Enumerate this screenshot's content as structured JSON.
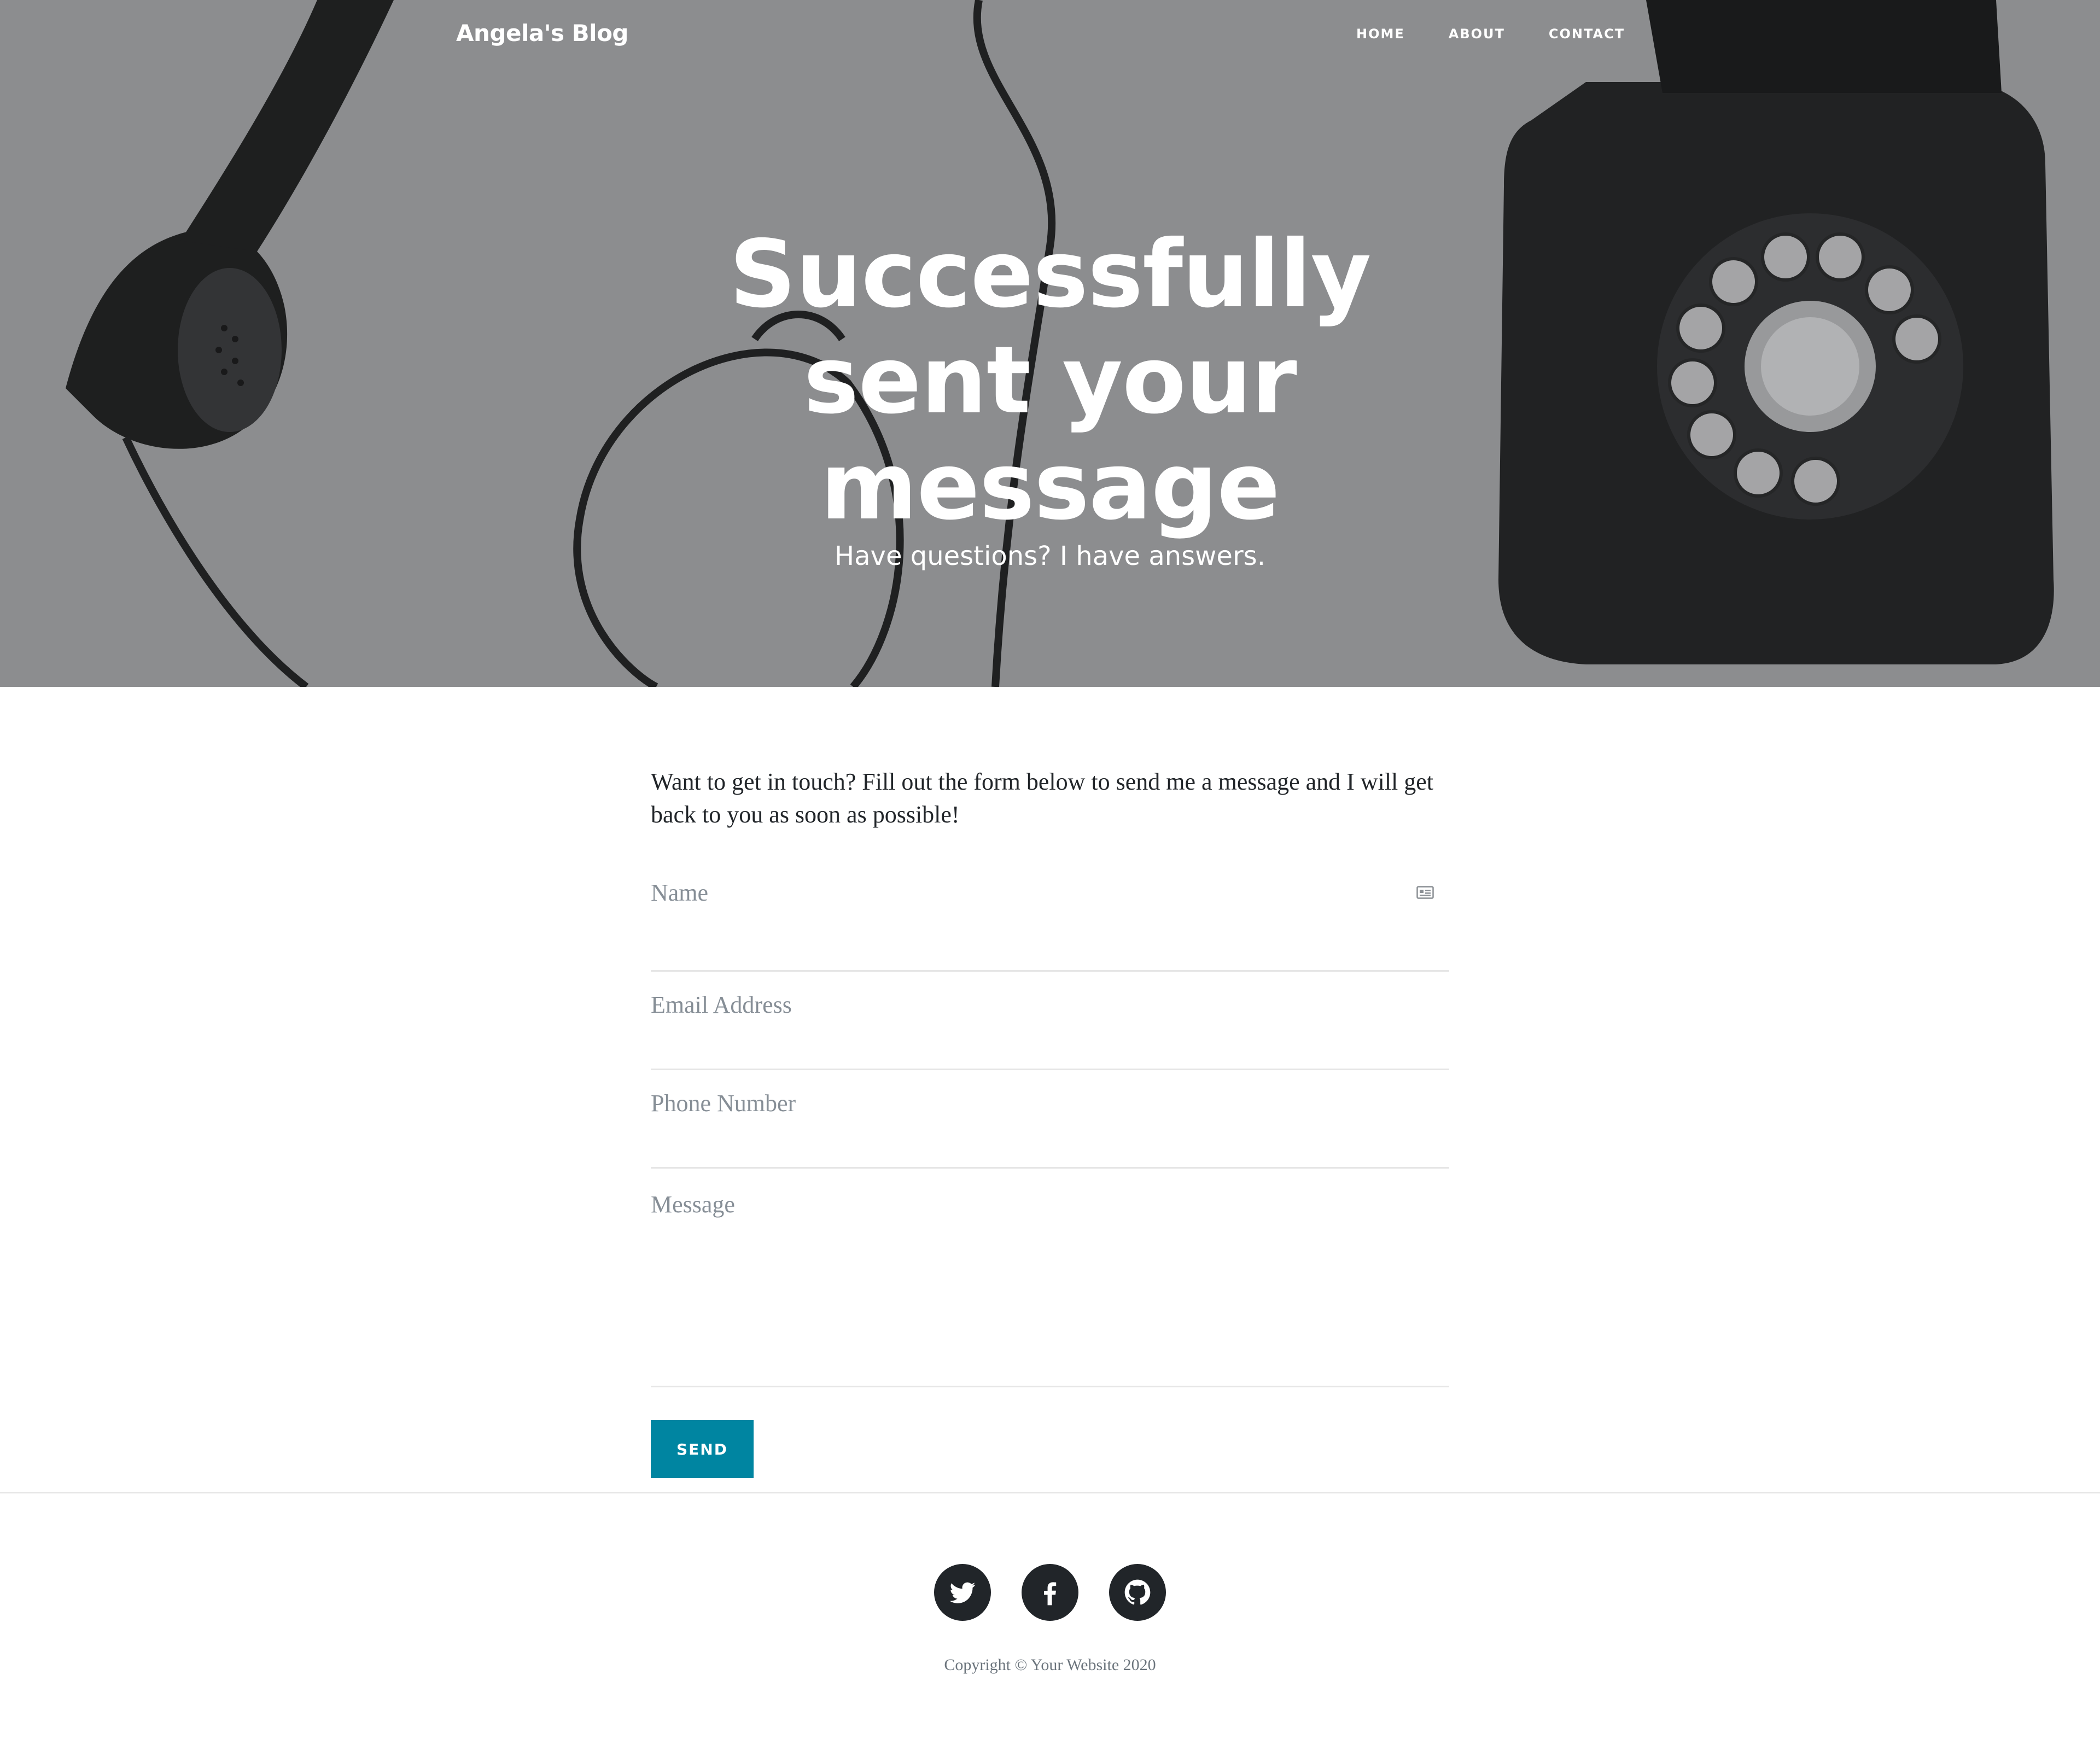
{
  "nav": {
    "brand": "Angela's Blog",
    "links": [
      "HOME",
      "ABOUT",
      "CONTACT"
    ]
  },
  "hero": {
    "title": "Successfully sent your message",
    "subtitle": "Have questions? I have answers."
  },
  "contact": {
    "intro": "Want to get in touch? Fill out the form below to send me a message and I will get back to you as soon as possible!",
    "fields": {
      "name_placeholder": "Name",
      "email_placeholder": "Email Address",
      "phone_placeholder": "Phone Number",
      "message_placeholder": "Message"
    },
    "send_label": "SEND"
  },
  "footer": {
    "socials": [
      "twitter-icon",
      "facebook-icon",
      "github-icon"
    ],
    "copyright": "Copyright © Your Website 2020"
  },
  "colors": {
    "accent": "#0085a1",
    "dark": "#212529",
    "hero_gray": "#8b8c8e"
  }
}
